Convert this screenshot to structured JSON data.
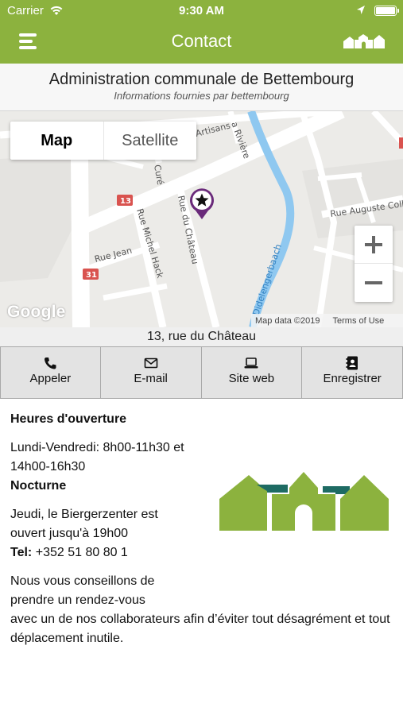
{
  "status_bar": {
    "carrier": "Carrier",
    "time": "9:30 AM"
  },
  "nav": {
    "title": "Contact",
    "menu_icon": "hamburger-menu-icon",
    "logo_icon": "bettembourg-logo-icon"
  },
  "header": {
    "name": "Administration communale de Bettembourg",
    "subtitle": "Informations fournies par bettembourg"
  },
  "map": {
    "type_control": {
      "map_label": "Map",
      "satellite_label": "Satellite",
      "selected": "Map"
    },
    "streets": [
      "Artisans",
      "a Rivière",
      "Curé",
      "Rue du Château",
      "Rue Michel Hack",
      "Rue Jean",
      "Rue Auguste Coll",
      "Didelengerbaach"
    ],
    "route_badges": [
      "13",
      "31"
    ],
    "google_logo": "Google",
    "attribution": "Map data ©2019",
    "terms": "Terms of Use",
    "marker_icon": "star-marker-icon"
  },
  "address": "13, rue du Château",
  "actions": [
    {
      "label": "Appeler",
      "icon": "phone-icon"
    },
    {
      "label": "E-mail",
      "icon": "envelope-icon"
    },
    {
      "label": "Site web",
      "icon": "laptop-icon"
    },
    {
      "label": "Enregistrer",
      "icon": "contact-book-icon"
    }
  ],
  "info": {
    "hours_heading": "Heures d'ouverture",
    "hours_text": "Lundi-Vendredi: 8h00-11h30 et 14h00-16h30",
    "nocturne_heading": "Nocturne",
    "nocturne_text": "Jeudi, le Biergerzenter est ouvert jusqu'à 19h00",
    "tel_label": "Tel:",
    "tel_value": "+352 51 80 80 1",
    "note_part1": "Nous vous conseillons de prendre un rendez-vous",
    "note_part2": "avec un de nos collaborateurs afin d’éviter tout désagrément et tout déplacement inutile."
  },
  "colors": {
    "brand": "#8cb23e",
    "brand_dark": "#1e6b63",
    "marker": "#6a2a7a",
    "water": "#8fc8f0"
  }
}
